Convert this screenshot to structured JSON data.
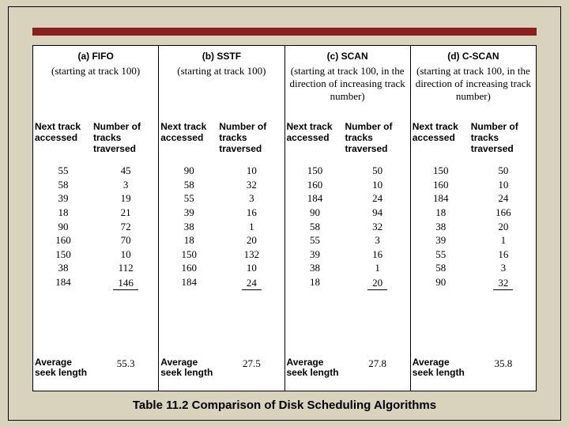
{
  "caption": "Table 11.2   Comparison of Disk Scheduling Algorithms",
  "headers": {
    "col1": "Next track accessed",
    "col2": "Number of tracks traversed",
    "avg": "Average seek length"
  },
  "columns": [
    {
      "title": "(a) FIFO",
      "start": "(starting at track 100)",
      "tracks": [
        55,
        58,
        39,
        18,
        90,
        160,
        150,
        38,
        184
      ],
      "traversed": [
        45,
        3,
        19,
        21,
        72,
        70,
        10,
        112,
        146
      ],
      "avg": "55.3"
    },
    {
      "title": "(b) SSTF",
      "start": "(starting at track 100)",
      "tracks": [
        90,
        58,
        55,
        39,
        38,
        18,
        150,
        160,
        184
      ],
      "traversed": [
        10,
        32,
        3,
        16,
        1,
        20,
        132,
        10,
        24
      ],
      "avg": "27.5"
    },
    {
      "title": "(c) SCAN",
      "start": "(starting at track 100, in the direction of increasing track number)",
      "tracks": [
        150,
        160,
        184,
        90,
        58,
        55,
        39,
        38,
        18
      ],
      "traversed": [
        50,
        10,
        24,
        94,
        32,
        3,
        16,
        1,
        20
      ],
      "avg": "27.8"
    },
    {
      "title": "(d) C-SCAN",
      "start": "(starting at track 100, in the direction of increasing track number)",
      "tracks": [
        150,
        160,
        184,
        18,
        38,
        39,
        55,
        58,
        90
      ],
      "traversed": [
        50,
        10,
        24,
        166,
        20,
        1,
        16,
        3,
        32
      ],
      "avg": "35.8"
    }
  ]
}
